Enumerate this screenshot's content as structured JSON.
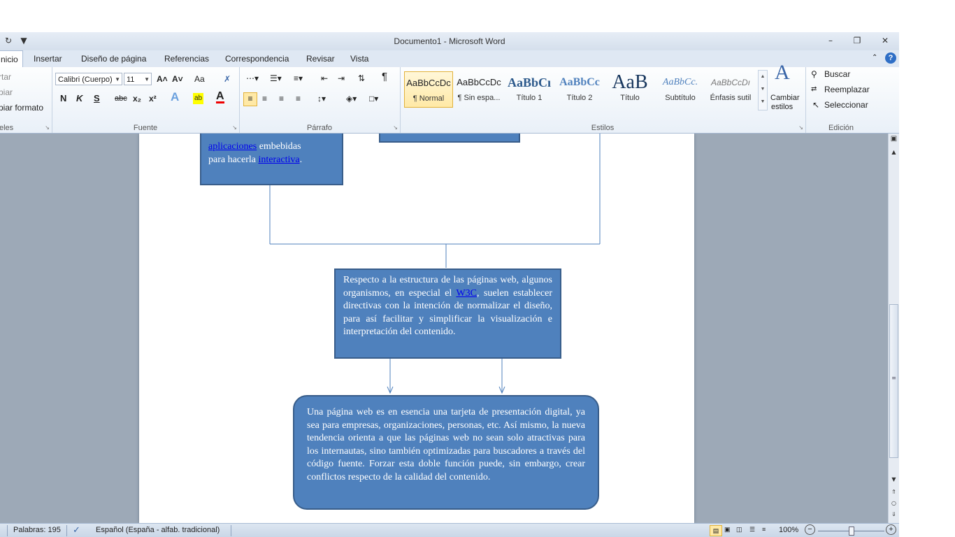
{
  "window": {
    "title": "Documento1  -  Microsoft Word",
    "quick_access": "↶",
    "min": "–",
    "restore": "❐",
    "close": "✕"
  },
  "tabs": [
    "nicio",
    "Insertar",
    "Diseño de página",
    "Referencias",
    "Correspondencia",
    "Revisar",
    "Vista"
  ],
  "ribbon": {
    "clipboard": {
      "cut": "rtar",
      "copy": "piar",
      "format_painter": "piar formato",
      "label": "eles"
    },
    "font": {
      "font_name": "Calibri (Cuerpo)",
      "font_size": "11",
      "grow": "A˄",
      "shrink": "A˅",
      "case": "Aa",
      "clear": "✗",
      "bold": "N",
      "italic": "K",
      "underline": "S",
      "strike": "abc",
      "subscript": "x₂",
      "superscript": "x²",
      "label": "Fuente"
    },
    "paragraph": {
      "label": "Párrafo",
      "pilcrow": "¶"
    },
    "styles": {
      "label": "Estilos",
      "items": [
        {
          "sample": "AaBbCcDc",
          "name": "¶ Normal"
        },
        {
          "sample": "AaBbCcDc",
          "name": "¶ Sin espa..."
        },
        {
          "sample": "AaBbCı",
          "name": "Título 1"
        },
        {
          "sample": "AaBbCc",
          "name": "Título 2"
        },
        {
          "sample": "AaB",
          "name": "Título"
        },
        {
          "sample": "AaBbCc.",
          "name": "Subtítulo"
        },
        {
          "sample": "AaBbCcDı",
          "name": "Énfasis sutil"
        }
      ],
      "change_styles_line1": "Cambiar",
      "change_styles_line2": "estilos"
    },
    "editing": {
      "label": "Edición",
      "find": "Buscar",
      "replace": "Reemplazar",
      "select": "Seleccionar"
    }
  },
  "document": {
    "box1": {
      "link1": "aplicaciones",
      "text1": " embebidas",
      "text2": "para hacerla ",
      "link2": "interactiva",
      "text3": "."
    },
    "box2": {
      "before_link": "Respecto a la estructura de las páginas web, algunos organismos, en especial el ",
      "link": "W3C",
      "after_link": ", suelen establecer directivas con la intención de normalizar el diseño, para así facilitar y simplificar la visualización e interpretación del contenido."
    },
    "box3": "Una página web es en esencia una tarjeta de presentación digital, ya sea para empresas, organizaciones, personas, etc. Así mismo, la nueva tendencia orienta a que las páginas web no sean solo atractivas para los internautas, sino también optimizadas para buscadores a través del código fuente. Forzar esta doble función puede, sin embargo, crear conflictos respecto de la calidad del contenido."
  },
  "status": {
    "words": "Palabras: 195",
    "language": "Español (España - alfab. tradicional)",
    "zoom": "100%",
    "zoom_fraction": 0.5
  },
  "colors": {
    "accent": "#4f81bd",
    "accent_border": "#385d8a",
    "link": "#0000ee"
  }
}
